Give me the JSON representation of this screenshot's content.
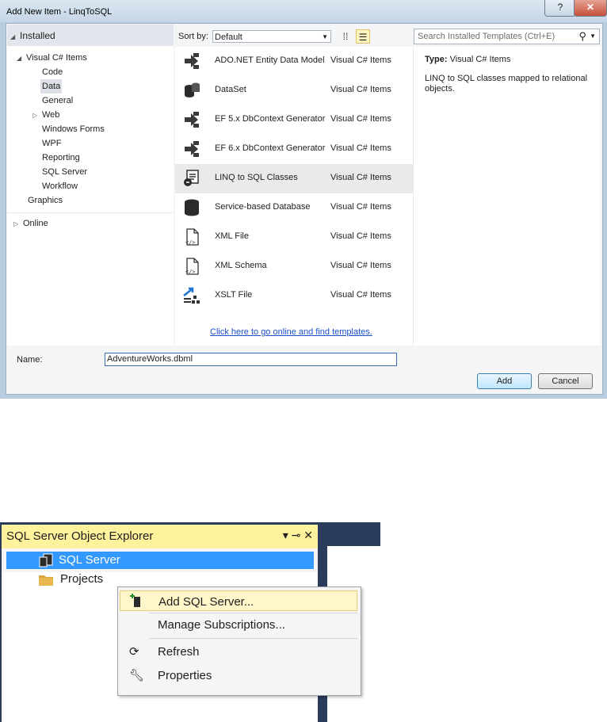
{
  "dialog": {
    "title": "Add New Item - LinqToSQL",
    "help_glyph": "?",
    "close_glyph": "✕"
  },
  "tree": {
    "installed": "Installed",
    "root": "Visual C# Items",
    "children": [
      "Code",
      "Data",
      "General",
      "Web",
      "Windows Forms",
      "WPF",
      "Reporting",
      "SQL Server",
      "Workflow"
    ],
    "graphics": "Graphics",
    "online": "Online",
    "selected": "Data"
  },
  "sortbar": {
    "label": "Sort by:",
    "value": "Default"
  },
  "templates": [
    {
      "name": "ADO.NET Entity Data Model",
      "category": "Visual C# Items",
      "icon": "entity-model-icon"
    },
    {
      "name": "DataSet",
      "category": "Visual C# Items",
      "icon": "database-icon"
    },
    {
      "name": "EF 5.x DbContext Generator",
      "category": "Visual C# Items",
      "icon": "entity-model-icon"
    },
    {
      "name": "EF 6.x DbContext Generator",
      "category": "Visual C# Items",
      "icon": "entity-model-icon"
    },
    {
      "name": "LINQ to SQL Classes",
      "category": "Visual C# Items",
      "icon": "linq-icon"
    },
    {
      "name": "Service-based Database",
      "category": "Visual C# Items",
      "icon": "database-icon"
    },
    {
      "name": "XML File",
      "category": "Visual C# Items",
      "icon": "xml-file-icon"
    },
    {
      "name": "XML Schema",
      "category": "Visual C# Items",
      "icon": "xml-file-icon"
    },
    {
      "name": "XSLT File",
      "category": "Visual C# Items",
      "icon": "xslt-icon"
    }
  ],
  "selected_template": "LINQ to SQL Classes",
  "online_link": "Click here to go online and find templates.",
  "search": {
    "placeholder": "Search Installed Templates (Ctrl+E)"
  },
  "info": {
    "type_label": "Type:",
    "type_value": "Visual C# Items",
    "description": "LINQ to SQL classes mapped to relational objects."
  },
  "name_field": {
    "label": "Name:",
    "value": "AdventureWorks.dbml"
  },
  "buttons": {
    "add": "Add",
    "cancel": "Cancel"
  },
  "explorer": {
    "title": "SQL Server Object Explorer",
    "controls": "▾ ⊸ ✕",
    "nodes": [
      {
        "label": "SQL Server",
        "icon": "sql-server-icon"
      },
      {
        "label": "Projects",
        "icon": "folder-icon"
      }
    ]
  },
  "context_menu": {
    "items": [
      {
        "label": "Add SQL Server...",
        "icon": "add-server-icon"
      },
      {
        "label": "Manage Subscriptions...",
        "icon": ""
      },
      {
        "label": "Refresh",
        "icon": "refresh-icon"
      },
      {
        "label": "Properties",
        "icon": "wrench-icon"
      }
    ]
  },
  "colors": {
    "accent": "#3399ff",
    "header_yellow": "#fff29d",
    "link": "#1a50c8"
  }
}
